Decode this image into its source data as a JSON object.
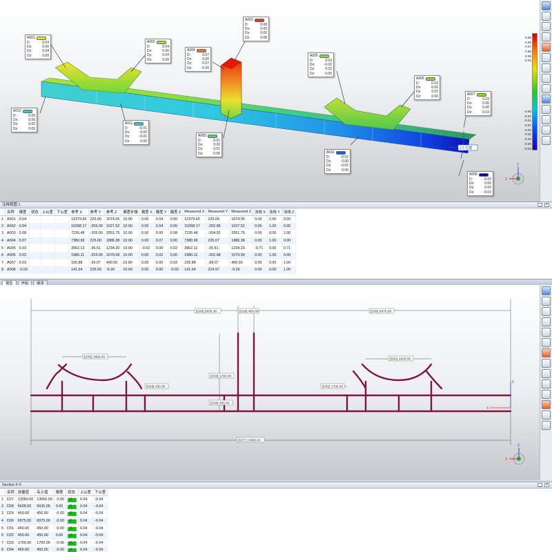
{
  "callouts": [
    {
      "id": "A001",
      "color": "#f0e020",
      "rows": [
        [
          "D:",
          "0.04"
        ],
        [
          "Dx:",
          "0.00"
        ],
        [
          "Dy:",
          "0.04"
        ],
        [
          "Dz:",
          "0.00"
        ]
      ]
    },
    {
      "id": "A002",
      "color": "#a8e030",
      "rows": [
        [
          "D:",
          "0.04"
        ],
        [
          "Dx:",
          "0.00"
        ],
        [
          "Dy:",
          "0.04"
        ],
        [
          "Dz:",
          "0.00"
        ]
      ]
    },
    {
      "id": "A003",
      "color": "#e03a1a",
      "rows": [
        [
          "D:",
          "0.08"
        ],
        [
          "Dx:",
          "0.00"
        ],
        [
          "Dy:",
          "0.00"
        ],
        [
          "Dz:",
          "0.08"
        ]
      ]
    },
    {
      "id": "A004",
      "color": "#f07020",
      "rows": [
        [
          "D:",
          "0.07"
        ],
        [
          "Dx:",
          "0.00"
        ],
        [
          "Dy:",
          "0.07"
        ],
        [
          "Dz:",
          "0.00"
        ]
      ]
    },
    {
      "id": "A005",
      "color": "#80d830",
      "rows": [
        [
          "D:",
          "0.03"
        ],
        [
          "Dx:",
          "-0.02"
        ],
        [
          "Dy:",
          "0.02"
        ],
        [
          "Dz:",
          "0.00"
        ]
      ]
    },
    {
      "id": "A006",
      "color": "#80d830",
      "rows": [
        [
          "D:",
          "0.02"
        ],
        [
          "Dx:",
          "0.00"
        ],
        [
          "Dy:",
          "0.02"
        ],
        [
          "Dz:",
          "0.00"
        ]
      ]
    },
    {
      "id": "A007",
      "color": "#80d830",
      "rows": [
        [
          "D:",
          "0.03"
        ],
        [
          "Dx:",
          "0.00"
        ],
        [
          "Dy:",
          "0.00"
        ],
        [
          "Dz:",
          "0.03"
        ]
      ]
    },
    {
      "id": "A008",
      "color": "#001090",
      "rows": [
        [
          "D:",
          "-0.03"
        ],
        [
          "Dx:",
          "0.00"
        ],
        [
          "Dy:",
          "0.00"
        ],
        [
          "Dz:",
          "-0.03"
        ]
      ]
    },
    {
      "id": "A009",
      "color": "#40d870",
      "rows": [
        [
          "D:",
          "0.01"
        ],
        [
          "Dx:",
          "0.00"
        ],
        [
          "Dy:",
          "0.01"
        ],
        [
          "Dz:",
          "0.00"
        ]
      ]
    },
    {
      "id": "A010",
      "color": "#30c8d8",
      "rows": [
        [
          "D:",
          "0.00"
        ],
        [
          "Dx:",
          "0.00"
        ],
        [
          "Dy:",
          "0.00"
        ],
        [
          "Dz:",
          "0.00"
        ]
      ]
    },
    {
      "id": "A011",
      "color": "#30c8d8",
      "rows": [
        [
          "D:",
          "-0.01"
        ],
        [
          "Dx:",
          "0.00"
        ],
        [
          "Dy:",
          "-0.01"
        ],
        [
          "Dz:",
          "0.00"
        ]
      ]
    },
    {
      "id": "A012",
      "color": "#1060e0",
      "rows": [
        [
          "D:",
          "-0.02"
        ],
        [
          "Dx:",
          "0.00"
        ],
        [
          "Dy:",
          "-0.02"
        ],
        [
          "Dz:",
          "0.00"
        ]
      ]
    }
  ],
  "scale_labels": [
    "0.08",
    "0.08",
    "0.07",
    "0.06",
    "0.05",
    "0.04",
    "",
    "",
    "",
    "",
    "",
    "",
    "",
    "",
    "",
    "",
    "-0.00",
    "-0.01",
    "-0.01",
    "-0.01",
    "-0.02",
    "-0.02",
    "-0.03",
    "-0.03",
    "-0.03"
  ],
  "view_label_3d": "1.5 位置",
  "annotation_panel": {
    "title": "注释视图 1",
    "headers": [
      "",
      "名称",
      "偏差",
      "状态",
      "上公差",
      "下公差",
      "参考 X",
      "参考 Y",
      "参考 Z",
      "偏差补偿",
      "偏差 X",
      "偏差 Y",
      "偏差 Z",
      "Measured X",
      "Measured Y",
      "Measured Z",
      "法线 X",
      "法线 Y",
      "法线 Z"
    ],
    "rows": [
      [
        "1",
        "A001",
        "0.04",
        "",
        "",
        "",
        "12379.65",
        "225.00",
        "1074.05",
        "10.00",
        "0.00",
        "0.04",
        "0.00",
        "12379.65",
        "225.04",
        "1074.05",
        "0.00",
        "1.00",
        "0.00"
      ],
      [
        "2",
        "A002",
        "0.04",
        "",
        "",
        "",
        "10268.17",
        "-203.00",
        "1027.52",
        "10.00",
        "0.00",
        "0.04",
        "0.00",
        "10268.17",
        "-202.96",
        "1027.52",
        "0.00",
        "1.00",
        "0.00"
      ],
      [
        "3",
        "A003",
        "0.08",
        "",
        "",
        "",
        "7226.48",
        "-205.00",
        "2051.75",
        "10.00",
        "0.00",
        "0.00",
        "0.08",
        "7226.48",
        "-204.92",
        "2051.75",
        "0.00",
        "0.00",
        "1.00"
      ],
      [
        "4",
        "A004",
        "0.07",
        "",
        "",
        "",
        "7380.96",
        "225.00",
        "1886.38",
        "10.00",
        "0.00",
        "0.07",
        "0.00",
        "7380.96",
        "225.07",
        "1886.38",
        "0.00",
        "1.00",
        "0.00"
      ],
      [
        "5",
        "A005",
        "0.03",
        "",
        "",
        "",
        "3962.13",
        "-35.51",
        "1234.20",
        "10.00",
        "-0.02",
        "0.00",
        "0.02",
        "3962.11",
        "-35.51",
        "1234.23",
        "-0.71",
        "0.00",
        "0.71"
      ],
      [
        "6",
        "A006",
        "0.02",
        "",
        "",
        "",
        "1980.11",
        "-203.00",
        "1079.99",
        "10.00",
        "0.00",
        "0.02",
        "0.00",
        "1980.11",
        "-202.98",
        "1079.99",
        "0.00",
        "1.00",
        "0.00"
      ],
      [
        "7",
        "A007",
        "0.03",
        "",
        "",
        "",
        "155.88",
        "-39.07",
        "400.00",
        "10.00",
        "0.00",
        "0.00",
        "0.03",
        "155.88",
        "-39.07",
        "400.03",
        "0.00",
        "0.00",
        "1.00"
      ],
      [
        "8",
        "A008",
        "-0.03",
        "",
        "",
        "",
        "141.54",
        "225.00",
        "-5.26",
        "10.00",
        "0.00",
        "0.00",
        "-0.03",
        "141.54",
        "224.97",
        "-5.26",
        "0.00",
        "0.00",
        "1.00"
      ]
    ]
  },
  "tabs": [
    "模型",
    "开始",
    "版本"
  ],
  "dimensions": {
    "d26": "[D26] 5635.00",
    "d28": "[D28] 450.00",
    "d30": "[D30] 6975.00",
    "d31": "[D31] 1000.00",
    "d32": "[D32] 1700.00",
    "d33": "[D33] 1700.00",
    "d35": "[D35] 1800.00",
    "d36": "[D36] 450.00",
    "d29": "[D29] 450.00",
    "d34": "[D34] 450.00",
    "d27": "[D27] 13060.00"
  },
  "section_panel": {
    "title": "Section F-F",
    "headers": [
      "",
      "名称",
      "测量值",
      "名义值",
      "偏差",
      "状态",
      "上公差",
      "下公差"
    ],
    "rows": [
      [
        "1",
        "D27",
        "13060.00",
        "13060.00",
        "-0.00",
        "通过",
        "0.04",
        "-0.04"
      ],
      [
        "2",
        "D28",
        "5635.00",
        "5635.00",
        "0.00",
        "通过",
        "0.04",
        "-0.04"
      ],
      [
        "3",
        "D29",
        "450.00",
        "450.00",
        "-0.00",
        "通过",
        "0.04",
        "-0.04"
      ],
      [
        "4",
        "D30",
        "6975.00",
        "6975.00",
        "-0.00",
        "通过",
        "0.04",
        "-0.04"
      ],
      [
        "5",
        "D31",
        "450.00",
        "450.00",
        "-0.00",
        "通过",
        "0.04",
        "-0.04"
      ],
      [
        "6",
        "D32",
        "450.00",
        "450.00",
        "0.00",
        "通过",
        "0.04",
        "-0.04"
      ],
      [
        "7",
        "D33",
        "1700.00",
        "1700.00",
        "-0.00",
        "通过",
        "0.04",
        "-0.04"
      ],
      [
        "8",
        "D34",
        "450.00",
        "450.00",
        "-0.00",
        "通过",
        "0.04",
        "-0.04"
      ]
    ]
  },
  "axis_labels": {
    "x": "X",
    "y": "Y",
    "z": "Z"
  }
}
